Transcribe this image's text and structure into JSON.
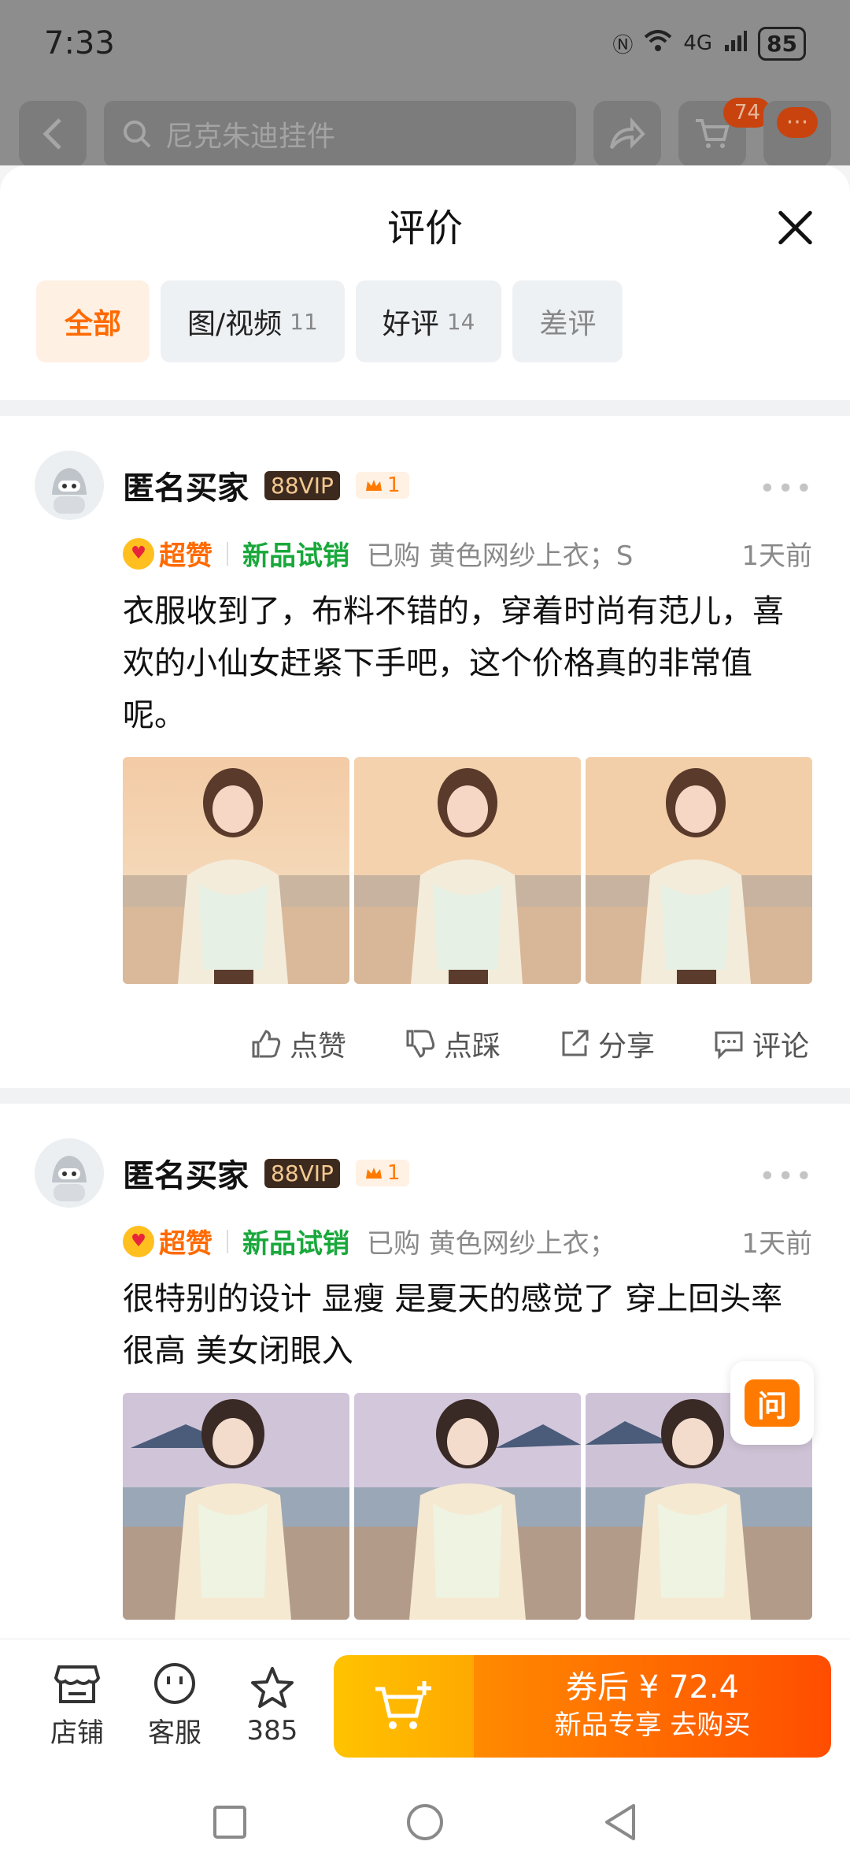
{
  "status": {
    "time": "7:33",
    "battery": "85",
    "signal": "4G"
  },
  "topbar": {
    "search_placeholder": "尼克朱迪挂件",
    "cart_badge": "74",
    "more": "···"
  },
  "sheet": {
    "title": "评价",
    "tabs": [
      {
        "label": "全部",
        "count": ""
      },
      {
        "label": "图/视频",
        "count": "11"
      },
      {
        "label": "好评",
        "count": "14"
      },
      {
        "label": "差评",
        "count": ""
      }
    ]
  },
  "reviews": [
    {
      "user": "匿名买家",
      "vip": "88VIP",
      "level": "1",
      "badge": "超赞",
      "trial": "新品试销",
      "purchased": "已购 黄色网纱上衣；S",
      "ago": "1天前",
      "text": "衣服收到了，布料不错的，穿着时尚有范儿，喜欢的小仙女赶紧下手吧，这个价格真的非常值呢。",
      "actions": {
        "like": "点赞",
        "dislike": "点踩",
        "share": "分享",
        "comment": "评论"
      }
    },
    {
      "user": "匿名买家",
      "vip": "88VIP",
      "level": "1",
      "badge": "超赞",
      "trial": "新品试销",
      "purchased": "已购 黄色网纱上衣；",
      "ago": "1天前",
      "text": "很特别的设计 显瘦 是夏天的感觉了 穿上回头率很高 美女闭眼入"
    }
  ],
  "ask": "问",
  "bottom": {
    "store": "店铺",
    "service": "客服",
    "favorites": "385",
    "price_line": "券后 ¥ 72.4",
    "buy_line": "新品专享  去购买"
  },
  "colors": {
    "accent": "#ff6a00",
    "green": "#19a83b"
  }
}
